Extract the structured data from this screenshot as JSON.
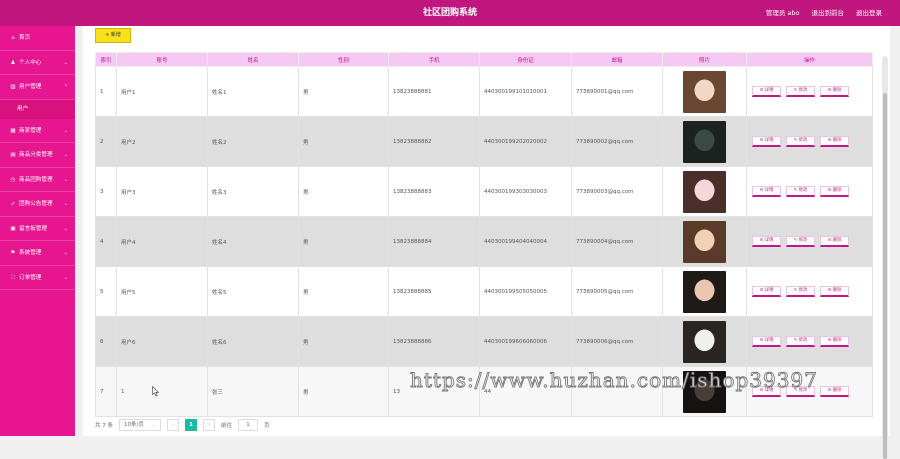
{
  "header": {
    "title": "社区团购系统",
    "admin": "管理员 abo",
    "back_to_front": "退出到前台",
    "logout": "退出登录"
  },
  "sidebar": {
    "items": [
      {
        "label": "首页",
        "icon": "home-icon",
        "has_chevron": false
      },
      {
        "label": "个人中心",
        "icon": "user-icon",
        "has_chevron": true
      },
      {
        "label": "用户管理",
        "icon": "chart-icon",
        "has_chevron": true
      },
      {
        "label": "商家管理",
        "icon": "shop-icon",
        "has_chevron": true
      },
      {
        "label": "商品分类管理",
        "icon": "grid-icon",
        "has_chevron": true
      },
      {
        "label": "商品团购管理",
        "icon": "clock-icon",
        "has_chevron": true
      },
      {
        "label": "团购公告管理",
        "icon": "send-icon",
        "has_chevron": true
      },
      {
        "label": "留言板管理",
        "icon": "message-icon",
        "has_chevron": true
      },
      {
        "label": "系统管理",
        "icon": "settings-icon",
        "has_chevron": true
      },
      {
        "label": "订单管理",
        "icon": "order-icon",
        "has_chevron": true
      }
    ],
    "sub_item": "用户"
  },
  "toolbar": {
    "add_label": "+ 新增"
  },
  "table": {
    "columns": [
      "索引",
      "账号",
      "姓名",
      "性别",
      "手机",
      "身份证",
      "邮箱",
      "照片",
      "操作"
    ],
    "rows": [
      {
        "index": "1",
        "account": "用户1",
        "name": "姓名1",
        "gender": "男",
        "phone": "13823888881",
        "id_card": "440300199101010001",
        "email": "773890001@qq.com",
        "photo_colors": [
          "#f3d7c6",
          "#6b4632"
        ]
      },
      {
        "index": "2",
        "account": "用户2",
        "name": "姓名2",
        "gender": "男",
        "phone": "13823888882",
        "id_card": "440300199202020002",
        "email": "773890002@qq.com",
        "photo_colors": [
          "#3b4a44",
          "#1b2220"
        ]
      },
      {
        "index": "3",
        "account": "用户3",
        "name": "姓名3",
        "gender": "男",
        "phone": "13823888883",
        "id_card": "440300199303030003",
        "email": "773890003@qq.com",
        "photo_colors": [
          "#f6d6d9",
          "#4a2e2a"
        ]
      },
      {
        "index": "4",
        "account": "用户4",
        "name": "姓名4",
        "gender": "男",
        "phone": "13823888884",
        "id_card": "440300199404040004",
        "email": "773890004@qq.com",
        "photo_colors": [
          "#f2cfb5",
          "#5a3a28"
        ]
      },
      {
        "index": "5",
        "account": "用户5",
        "name": "姓名5",
        "gender": "男",
        "phone": "13823888885",
        "id_card": "440300199505050005",
        "email": "773890005@qq.com",
        "photo_colors": [
          "#e8c6b0",
          "#1e1a18"
        ]
      },
      {
        "index": "6",
        "account": "用户6",
        "name": "姓名6",
        "gender": "男",
        "phone": "13823888886",
        "id_card": "440300199606060006",
        "email": "773890006@qq.com",
        "photo_colors": [
          "#f0f0ee",
          "#2a2422"
        ]
      },
      {
        "index": "7",
        "account": "1",
        "name": "张三",
        "gender": "男",
        "phone": "13",
        "id_card": "44",
        "email": "",
        "photo_colors": [
          "#4a3d35",
          "#161212"
        ]
      }
    ],
    "ops": {
      "detail": "☰ 详情",
      "edit": "✎ 修改",
      "delete": "☰ 删除"
    }
  },
  "pager": {
    "total": "共 7 条",
    "page_size": "10条/页",
    "prev": "‹",
    "current": "1",
    "next": "›",
    "goto": "前往",
    "goto_value": "1",
    "page_unit": "页"
  },
  "watermark": "https://www.huzhan.com/ishop39397"
}
